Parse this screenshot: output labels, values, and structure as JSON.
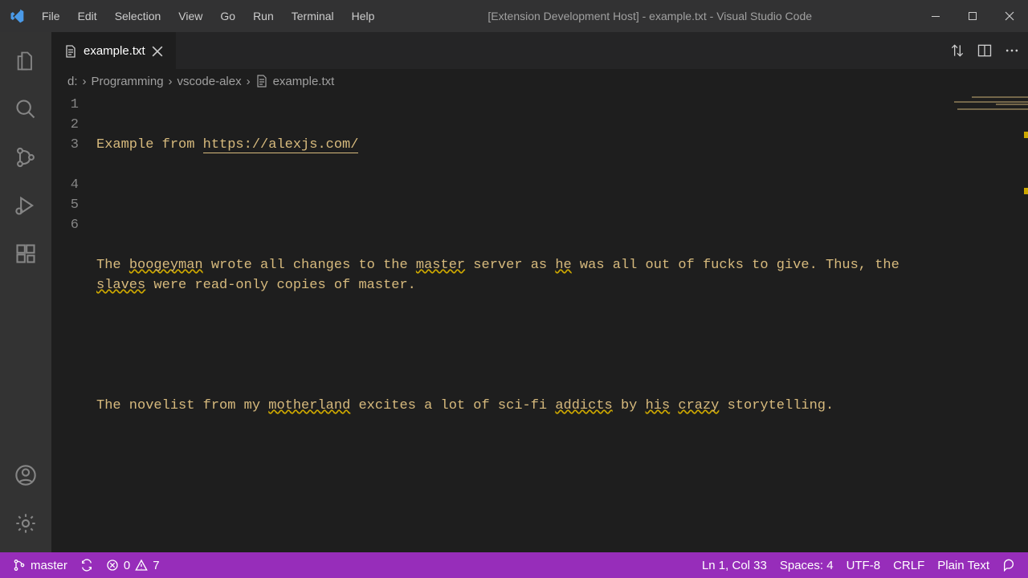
{
  "window": {
    "title": "[Extension Development Host] - example.txt - Visual Studio Code"
  },
  "menu": {
    "file": "File",
    "edit": "Edit",
    "selection": "Selection",
    "view": "View",
    "go": "Go",
    "run": "Run",
    "terminal": "Terminal",
    "help": "Help"
  },
  "tab": {
    "filename": "example.txt"
  },
  "breadcrumb": {
    "drive": "d:",
    "folder1": "Programming",
    "folder2": "vscode-alex",
    "file": "example.txt"
  },
  "editor": {
    "lines": [
      "1",
      "2",
      "3",
      "4",
      "5",
      "6"
    ],
    "line1_pre": "Example from ",
    "line1_url": "https://alexjs.com/",
    "line3_a": "The ",
    "line3_b": "boogeyman",
    "line3_c": " wrote all changes to the ",
    "line3_d": "master",
    "line3_e": " server as ",
    "line3_f": "he",
    "line3_g": " was all out of fucks to give. Thus, the ",
    "line3_h": "slaves",
    "line3_i": " were read-only copies of master.",
    "line5_a": "The novelist from my ",
    "line5_b": "motherland",
    "line5_c": " excites a lot of sci-fi ",
    "line5_d": "addicts",
    "line5_e": " by ",
    "line5_f": "his",
    "line5_g": " ",
    "line5_h": "crazy",
    "line5_i": " storytelling."
  },
  "status": {
    "branch": "master",
    "errors": "0",
    "warnings": "7",
    "position": "Ln 1, Col 33",
    "spaces": "Spaces: 4",
    "encoding": "UTF-8",
    "eol": "CRLF",
    "language": "Plain Text"
  }
}
